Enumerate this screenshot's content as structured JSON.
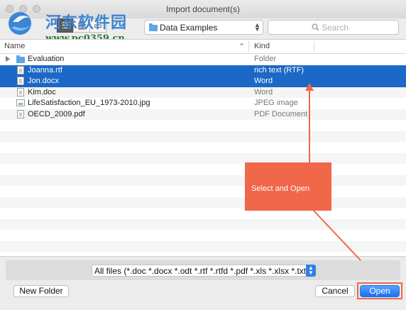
{
  "window": {
    "title": "Import document(s)"
  },
  "watermark": {
    "site_name": "河东软件园",
    "url": "www.pc0359.cn"
  },
  "toolbar": {
    "location": "Data Examples",
    "search_placeholder": "Search",
    "view_buttons": [
      {
        "name": "list-view-icon",
        "glyph": "☰",
        "active": true
      },
      {
        "name": "column-view-icon",
        "glyph": "▥",
        "active": false
      },
      {
        "name": "coverflow-view-icon",
        "glyph": "▭",
        "active": false
      }
    ]
  },
  "columns": {
    "name": "Name",
    "kind": "Kind",
    "sort_glyph": "⌃"
  },
  "files": [
    {
      "name": "Evaluation",
      "kind": "Folder",
      "icon": "folder-icon",
      "selected": false,
      "expandable": true
    },
    {
      "name": "Joanna.rtf",
      "kind": "rich text (RTF)",
      "icon": "document-icon",
      "selected": true,
      "expandable": false
    },
    {
      "name": "Jon.docx",
      "kind": "Word",
      "icon": "document-icon",
      "selected": true,
      "expandable": false
    },
    {
      "name": "Kim.doc",
      "kind": "Word",
      "icon": "document-icon",
      "selected": false,
      "expandable": false
    },
    {
      "name": "LifeSatisfaction_EU_1973-2010.jpg",
      "kind": "JPEG image",
      "icon": "image-icon",
      "selected": false,
      "expandable": false
    },
    {
      "name": "OECD_2009.pdf",
      "kind": "PDF Document",
      "icon": "pdf-icon",
      "selected": false,
      "expandable": false
    }
  ],
  "callout": {
    "text": "Select and Open",
    "color": "#f0674a"
  },
  "filter": {
    "value": "All files (*.doc *.docx *.odt *.rtf *.rtfd *.pdf *.xls *.xlsx *.txt..."
  },
  "buttons": {
    "new_folder": "New Folder",
    "cancel": "Cancel",
    "open": "Open"
  },
  "colors": {
    "selection": "#1b68c6",
    "accent": "#1d6ff0"
  }
}
